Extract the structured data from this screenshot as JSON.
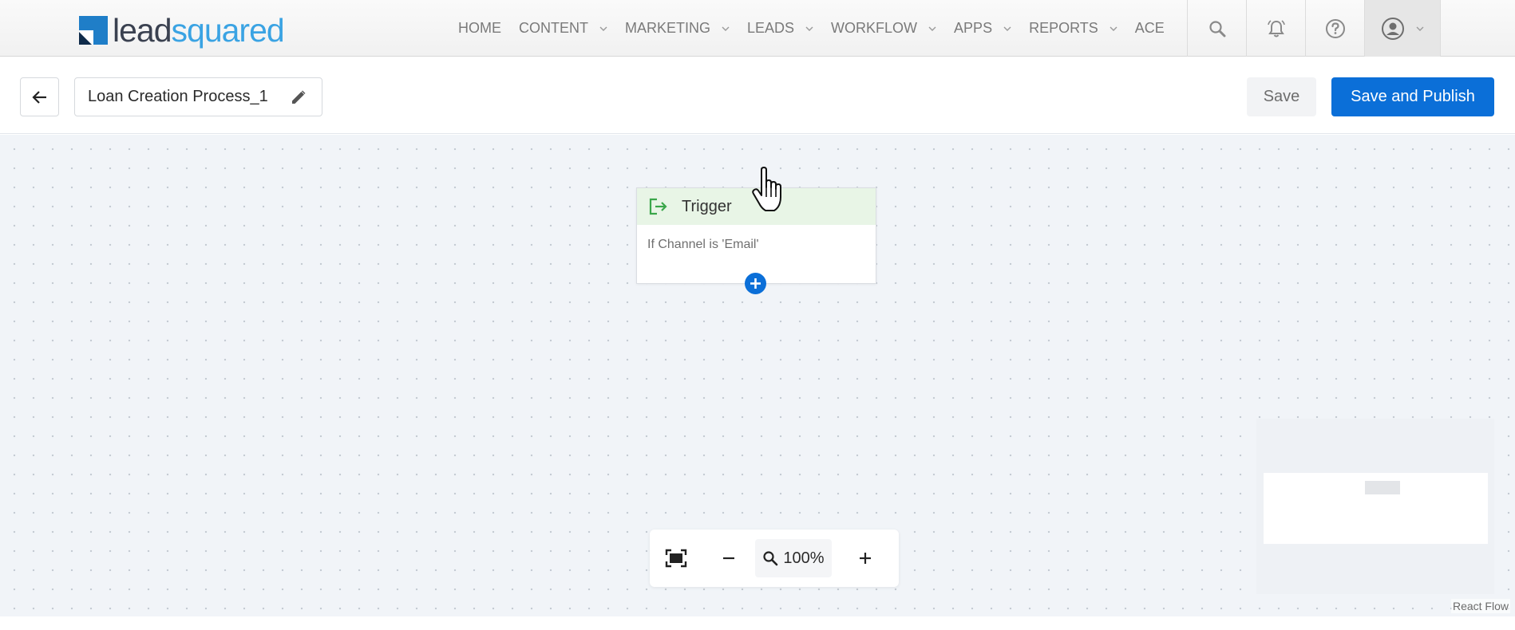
{
  "brand": {
    "logo_text_a": "lead",
    "logo_text_b": "squared"
  },
  "nav": {
    "items": [
      {
        "label": "HOME",
        "has_dropdown": false
      },
      {
        "label": "CONTENT",
        "has_dropdown": true
      },
      {
        "label": "MARKETING",
        "has_dropdown": true
      },
      {
        "label": "LEADS",
        "has_dropdown": true
      },
      {
        "label": "WORKFLOW",
        "has_dropdown": true
      },
      {
        "label": "APPS",
        "has_dropdown": true
      },
      {
        "label": "REPORTS",
        "has_dropdown": true
      },
      {
        "label": "ACE",
        "has_dropdown": false
      }
    ],
    "icons": [
      "search-icon",
      "bell-icon",
      "help-icon",
      "user-avatar-icon"
    ]
  },
  "toolbar": {
    "process_name": "Loan Creation Process_1",
    "save_label": "Save",
    "publish_label": "Save and Publish"
  },
  "canvas": {
    "trigger_node": {
      "title": "Trigger",
      "condition": "If Channel is 'Email'"
    },
    "zoom_level": "100%",
    "attribution": "React Flow"
  },
  "colors": {
    "accent": "#0b6fd8",
    "trigger_header": "#e8f5e6",
    "trigger_icon": "#3aa64a",
    "canvas_bg": "#f1f4f8"
  }
}
